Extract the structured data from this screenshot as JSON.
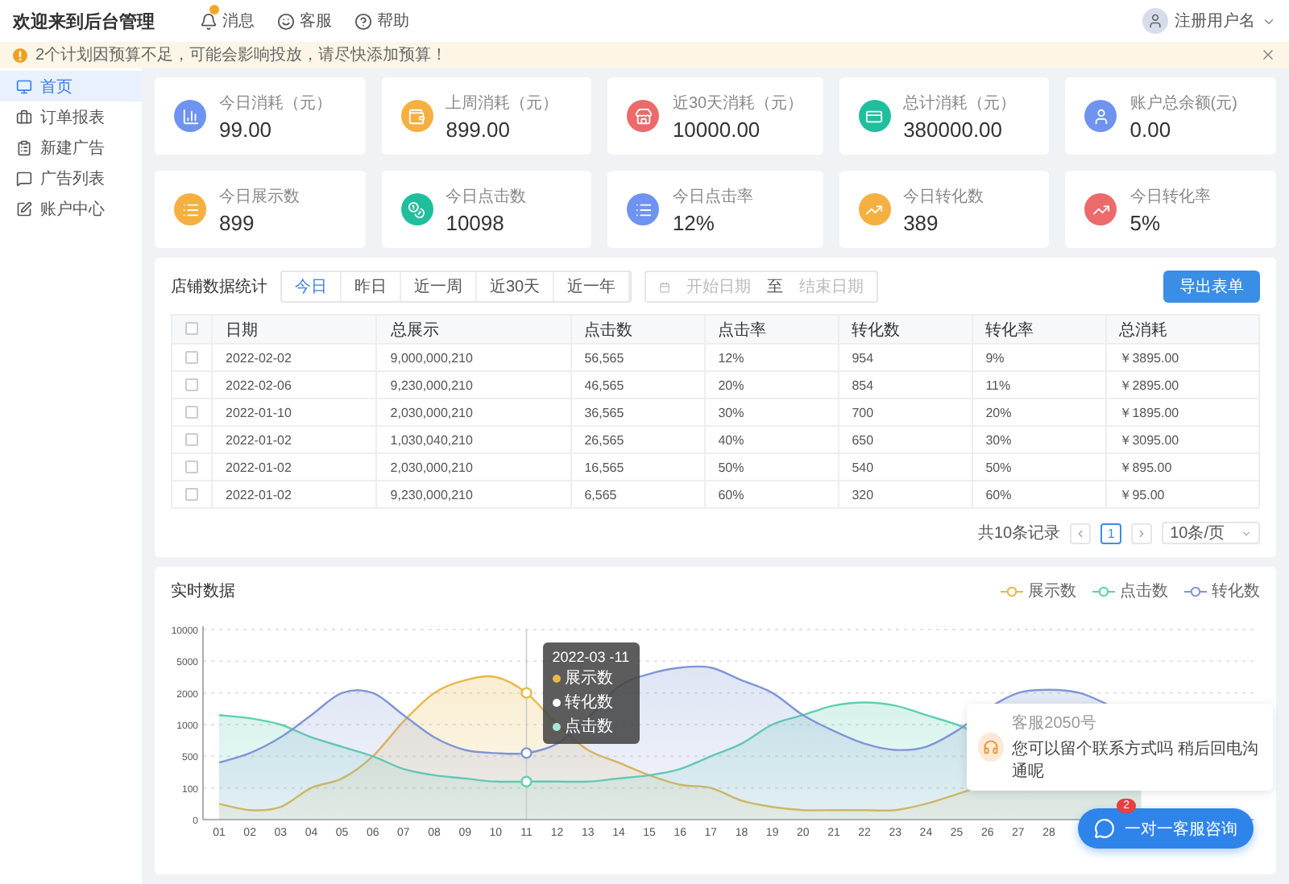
{
  "header": {
    "title": "欢迎来到后台管理",
    "nav": [
      {
        "kind": "bell",
        "label": "消息",
        "notification": true
      },
      {
        "kind": "smile",
        "label": "客服",
        "notification": false
      },
      {
        "kind": "help",
        "label": "帮助",
        "notification": false
      }
    ],
    "user": {
      "name": "注册用户名"
    }
  },
  "alert": {
    "text": "2个计划因预算不足，可能会影响投放，请尽快添加预算！"
  },
  "sidebar": {
    "items": [
      {
        "kind": "monitor",
        "label": "首页",
        "selected": true
      },
      {
        "kind": "briefcase",
        "label": "订单报表",
        "selected": false
      },
      {
        "kind": "clipboard",
        "label": "新建广告",
        "selected": false
      },
      {
        "kind": "message",
        "label": "广告列表",
        "selected": false
      },
      {
        "kind": "edit",
        "label": "账户中心",
        "selected": false
      }
    ]
  },
  "stats": [
    {
      "kind": "chart",
      "label": "今日消耗（元）",
      "value": "99.00",
      "color": "#6f93f0"
    },
    {
      "kind": "wallet",
      "label": "上周消耗（元）",
      "value": "899.00",
      "color": "#f5b041"
    },
    {
      "kind": "store",
      "label": "近30天消耗（元）",
      "value": "10000.00",
      "color": "#ec6a6a"
    },
    {
      "kind": "card",
      "label": "总计消耗（元）",
      "value": "380000.00",
      "color": "#1fbf9e"
    },
    {
      "kind": "user",
      "label": "账户总余额(元)",
      "value": "0.00",
      "color": "#6f93f0"
    },
    {
      "kind": "list",
      "label": "今日展示数",
      "value": "899",
      "color": "#f5b041"
    },
    {
      "kind": "money",
      "label": "今日点击数",
      "value": "10098",
      "color": "#1fbf9e"
    },
    {
      "kind": "list",
      "label": "今日点击率",
      "value": "12%",
      "color": "#6f93f0"
    },
    {
      "kind": "trend",
      "label": "今日转化数",
      "value": "389",
      "color": "#f5b041"
    },
    {
      "kind": "trend",
      "label": "今日转化率",
      "value": "5%",
      "color": "#ec6a6a"
    }
  ],
  "store_stats": {
    "title": "店铺数据统计",
    "ranges": [
      {
        "label": "今日",
        "selected": true
      },
      {
        "label": "昨日",
        "selected": false
      },
      {
        "label": "近一周",
        "selected": false
      },
      {
        "label": "近30天",
        "selected": false
      },
      {
        "label": "近一年",
        "selected": false
      }
    ],
    "date_range": {
      "start_placeholder": "开始日期",
      "separator": "至",
      "end_placeholder": "结束日期"
    },
    "export_button": "导出表单",
    "table": {
      "all_checked": false,
      "columns": [
        "日期",
        "总展示",
        "点击数",
        "点击率",
        "转化数",
        "转化率",
        "总消耗"
      ],
      "rows": [
        {
          "checked": false,
          "cells": [
            "2022-02-02",
            "9,000,000,210",
            "56,565",
            "12%",
            "954",
            "9%",
            "￥3895.00"
          ]
        },
        {
          "checked": false,
          "cells": [
            "2022-02-06",
            "9,230,000,210",
            "46,565",
            "20%",
            "854",
            "11%",
            "￥2895.00"
          ]
        },
        {
          "checked": false,
          "cells": [
            "2022-01-10",
            "2,030,000,210",
            "36,565",
            "30%",
            "700",
            "20%",
            "￥1895.00"
          ]
        },
        {
          "checked": false,
          "cells": [
            "2022-01-02",
            "1,030,040,210",
            "26,565",
            "40%",
            "650",
            "30%",
            "￥3095.00"
          ]
        },
        {
          "checked": false,
          "cells": [
            "2022-01-02",
            "2,030,000,210",
            "16,565",
            "50%",
            "540",
            "50%",
            "￥895.00"
          ]
        },
        {
          "checked": false,
          "cells": [
            "2022-01-02",
            "9,230,000,210",
            "6,565",
            "60%",
            "320",
            "60%",
            "￥95.00"
          ]
        }
      ]
    },
    "pagination": {
      "total": "共10条记录",
      "pages": [
        {
          "label": "1",
          "selected": true
        }
      ],
      "page_size": "10条/页"
    }
  },
  "realtime": {
    "title": "实时数据",
    "legend": [
      {
        "label": "展示数",
        "color": "#e8b84a"
      },
      {
        "label": "点击数",
        "color": "#5fcfb0"
      },
      {
        "label": "转化数",
        "color": "#7f96d6"
      }
    ],
    "y_axis_labels": [
      "10000",
      "5000",
      "2000",
      "1000",
      "500",
      "100",
      "0"
    ],
    "x_axis_labels": [
      "01",
      "02",
      "03",
      "04",
      "05",
      "06",
      "07",
      "08",
      "09",
      "10",
      "11",
      "12",
      "13",
      "14",
      "15",
      "16",
      "17",
      "18",
      "19",
      "20",
      "21",
      "22",
      "23",
      "24",
      "25",
      "26",
      "27",
      "28"
    ],
    "tooltip": {
      "title": "2022-03 -11",
      "items": [
        {
          "label": "展示数",
          "color": "#e8b84a"
        },
        {
          "label": "转化数",
          "color": "#ffffff"
        },
        {
          "label": "点击数",
          "color": "#a8e6d6"
        }
      ]
    }
  },
  "chat": {
    "agent": "客服2050号",
    "message": "您可以留个联系方式吗 稍后回电沟通呢",
    "button": "一对一客服咨询",
    "badge": "2"
  }
}
